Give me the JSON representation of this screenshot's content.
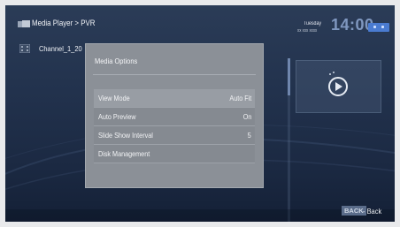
{
  "header": {
    "breadcrumb": "Media Player > PVR",
    "day": "Tuesday",
    "date": "xx xxx xxxx",
    "time": "14:00"
  },
  "file_list": {
    "items": [
      {
        "label": "Channel_1_20"
      }
    ]
  },
  "dialog": {
    "title": "Media Options",
    "options": [
      {
        "label": "View Mode",
        "value": "Auto Fit",
        "selected": true
      },
      {
        "label": "Auto Preview",
        "value": "On",
        "selected": false
      },
      {
        "label": "Slide Show Interval",
        "value": "5",
        "selected": false
      },
      {
        "label": "Disk Management",
        "value": "",
        "selected": false
      }
    ]
  },
  "footer": {
    "back_key": "BACK",
    "back_label": "- Back"
  },
  "colors": {
    "background": "#22324d",
    "dialog": "#8b9097",
    "accent": "#4a7bd0"
  },
  "icons": {
    "app": "media-folder-icon",
    "file": "video-file-icon",
    "preview": "play-icon"
  }
}
